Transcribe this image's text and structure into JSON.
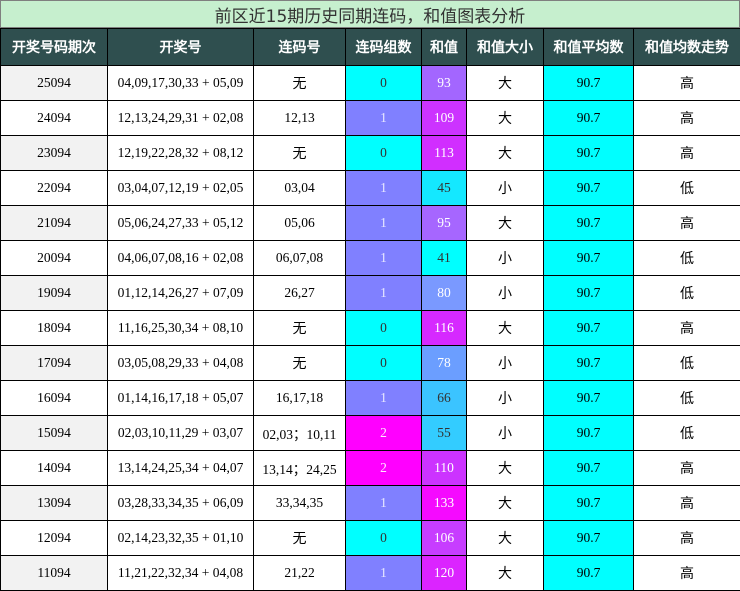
{
  "title": "前区近15期历史同期连码，和值图表分析",
  "headers": [
    "开奖号码期次",
    "开奖号",
    "连码号",
    "连码组数",
    "和值",
    "和值大小",
    "和值平均数",
    "和值均数走势"
  ],
  "group_colors": {
    "0": "#00ffff",
    "1": "#8080ff",
    "2": "#ff00ff"
  },
  "rows": [
    {
      "issue": "25094",
      "numbers": "04,09,17,30,33 + 05,09",
      "consec": "无",
      "groups": "0",
      "sum": "93",
      "sum_color": "#a366ff",
      "size": "大",
      "avg": "90.7",
      "trend": "高"
    },
    {
      "issue": "24094",
      "numbers": "12,13,24,29,31 + 02,08",
      "consec": "12,13",
      "groups": "1",
      "sum": "109",
      "sum_color": "#cc33ff",
      "size": "大",
      "avg": "90.7",
      "trend": "高"
    },
    {
      "issue": "23094",
      "numbers": "12,19,22,28,32 + 08,12",
      "consec": "无",
      "groups": "0",
      "sum": "113",
      "sum_color": "#d12eff",
      "size": "大",
      "avg": "90.7",
      "trend": "高"
    },
    {
      "issue": "22094",
      "numbers": "03,04,07,12,19 + 02,05",
      "consec": "03,04",
      "groups": "1",
      "sum": "45",
      "sum_color": "#14e8ff",
      "size": "小",
      "avg": "90.7",
      "trend": "低"
    },
    {
      "issue": "21094",
      "numbers": "05,06,24,27,33 + 05,12",
      "consec": "05,06",
      "groups": "1",
      "sum": "95",
      "sum_color": "#a666ff",
      "size": "大",
      "avg": "90.7",
      "trend": "高"
    },
    {
      "issue": "20094",
      "numbers": "04,06,07,08,16 + 02,08",
      "consec": "06,07,08",
      "groups": "1",
      "sum": "41",
      "sum_color": "#00ffff",
      "size": "小",
      "avg": "90.7",
      "trend": "低"
    },
    {
      "issue": "19094",
      "numbers": "01,12,14,26,27 + 07,09",
      "consec": "26,27",
      "groups": "1",
      "sum": "80",
      "sum_color": "#7a99ff",
      "size": "小",
      "avg": "90.7",
      "trend": "低"
    },
    {
      "issue": "18094",
      "numbers": "11,16,25,30,34 + 08,10",
      "consec": "无",
      "groups": "0",
      "sum": "116",
      "sum_color": "#d629ff",
      "size": "大",
      "avg": "90.7",
      "trend": "高"
    },
    {
      "issue": "17094",
      "numbers": "03,05,08,29,33 + 04,08",
      "consec": "无",
      "groups": "0",
      "sum": "78",
      "sum_color": "#6b9eff",
      "size": "小",
      "avg": "90.7",
      "trend": "低"
    },
    {
      "issue": "16094",
      "numbers": "01,14,16,17,18 + 05,07",
      "consec": "16,17,18",
      "groups": "1",
      "sum": "66",
      "sum_color": "#3bc4ff",
      "size": "小",
      "avg": "90.7",
      "trend": "低"
    },
    {
      "issue": "15094",
      "numbers": "02,03,10,11,29 + 03,07",
      "consec": "02,03；10,11",
      "groups": "2",
      "sum": "55",
      "sum_color": "#33ccff",
      "size": "小",
      "avg": "90.7",
      "trend": "低"
    },
    {
      "issue": "14094",
      "numbers": "13,14,24,25,34 + 04,07",
      "consec": "13,14；24,25",
      "groups": "2",
      "sum": "110",
      "sum_color": "#cc33ff",
      "size": "大",
      "avg": "90.7",
      "trend": "高"
    },
    {
      "issue": "13094",
      "numbers": "03,28,33,34,35 + 06,09",
      "consec": "33,34,35",
      "groups": "1",
      "sum": "133",
      "sum_color": "#f50aff",
      "size": "大",
      "avg": "90.7",
      "trend": "高"
    },
    {
      "issue": "12094",
      "numbers": "02,14,23,32,35 + 01,10",
      "consec": "无",
      "groups": "0",
      "sum": "106",
      "sum_color": "#c73dff",
      "size": "大",
      "avg": "90.7",
      "trend": "高"
    },
    {
      "issue": "11094",
      "numbers": "11,21,22,32,34 + 04,08",
      "consec": "21,22",
      "groups": "1",
      "sum": "120",
      "sum_color": "#db24ff",
      "size": "大",
      "avg": "90.7",
      "trend": "高"
    }
  ]
}
